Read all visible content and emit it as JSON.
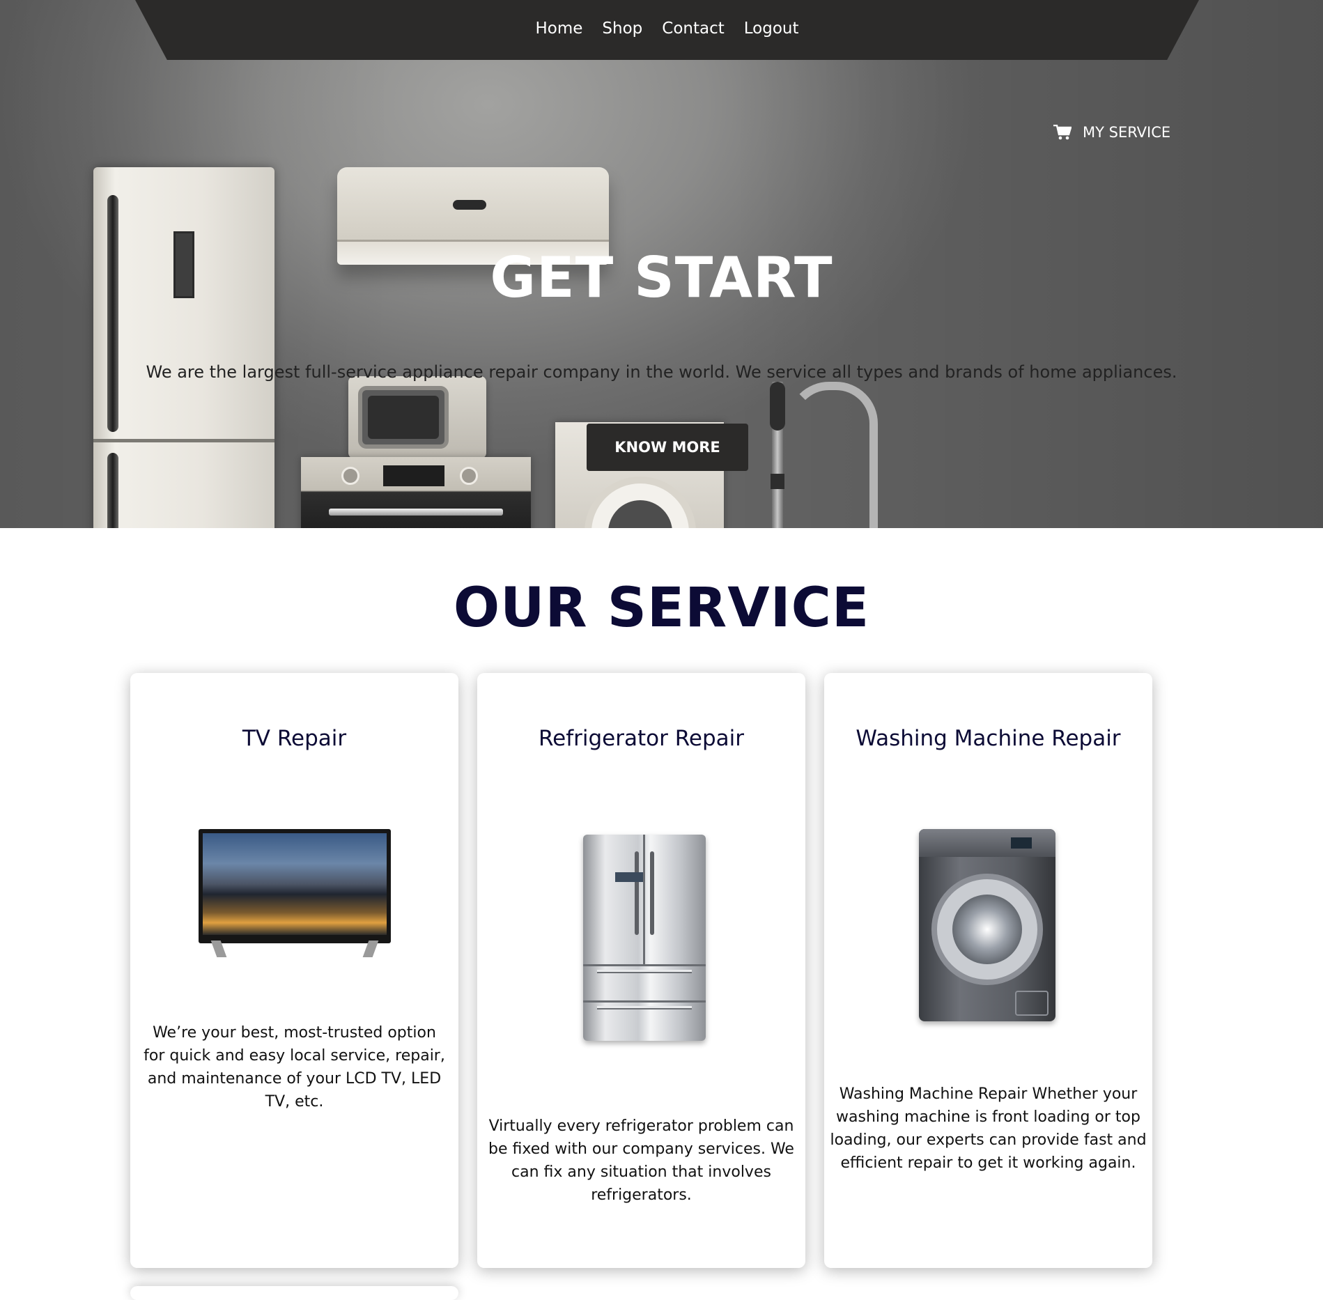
{
  "nav": {
    "items": [
      "Home",
      "Shop",
      "Contact",
      "Logout"
    ]
  },
  "header": {
    "cart_icon": "shopping-cart-icon",
    "my_service_label": "MY SERVICE"
  },
  "hero": {
    "title": "GET START",
    "description": "We are the largest full-service appliance repair company in the world. We service all types and brands of home appliances.",
    "button_label": "KNOW MORE"
  },
  "services": {
    "section_title": "OUR SERVICE",
    "cards": [
      {
        "title": "TV Repair",
        "description": "We’re your best, most-trusted option for quick and easy local service, repair, and maintenance of your LCD TV, LED TV, etc."
      },
      {
        "title": "Refrigerator Repair",
        "description": "Virtually every refrigerator problem can be fixed with our company services. We can fix any situation that involves refrigerators."
      },
      {
        "title": "Washing Machine Repair",
        "description": "Washing Machine Repair Whether your washing machine is front loading or top loading, our experts can provide fast and efficient repair to get it working again."
      }
    ]
  },
  "colors": {
    "nav_background": "#2b2a29",
    "heading_navy": "#0c0b35",
    "button_background": "#2b2a29"
  }
}
